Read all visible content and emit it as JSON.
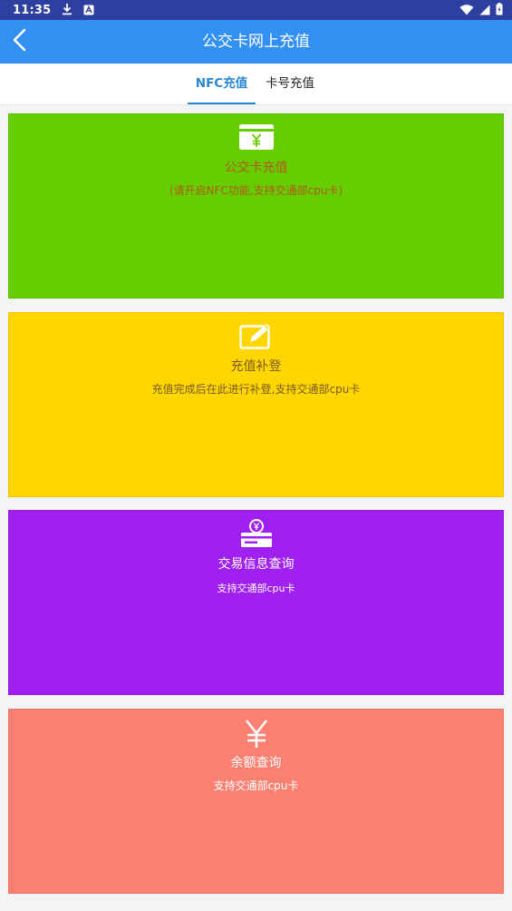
{
  "status_bar": {
    "time": "11:35",
    "background": "#2d3f9f"
  },
  "app_bar": {
    "title": "公交卡网上充值",
    "background": "#3390f3"
  },
  "tabs": [
    {
      "label": "NFC充值",
      "active": true
    },
    {
      "label": "卡号充值",
      "active": false
    }
  ],
  "cards": [
    {
      "title": "公交卡充值",
      "subtitle": "(请开启NFC功能,支持交通部cpu卡)",
      "background": "#66cd00",
      "text_color": "#b05a1a",
      "icon": "card-yuan-icon"
    },
    {
      "title": "充值补登",
      "subtitle": "充值完成后在此进行补登,支持交通部cpu卡",
      "background": "#ffd600",
      "text_color": "#7a5a2a",
      "icon": "edit-icon"
    },
    {
      "title": "交易信息查询",
      "subtitle": "支持交通部cpu卡",
      "background": "#a020f0",
      "text_color": "#ffffff",
      "icon": "wallet-yuan-icon"
    },
    {
      "title": "余额查询",
      "subtitle": "支持交通部cpu卡",
      "background": "#fa8072",
      "text_color": "#ffffff",
      "icon": "yuan-icon"
    }
  ]
}
